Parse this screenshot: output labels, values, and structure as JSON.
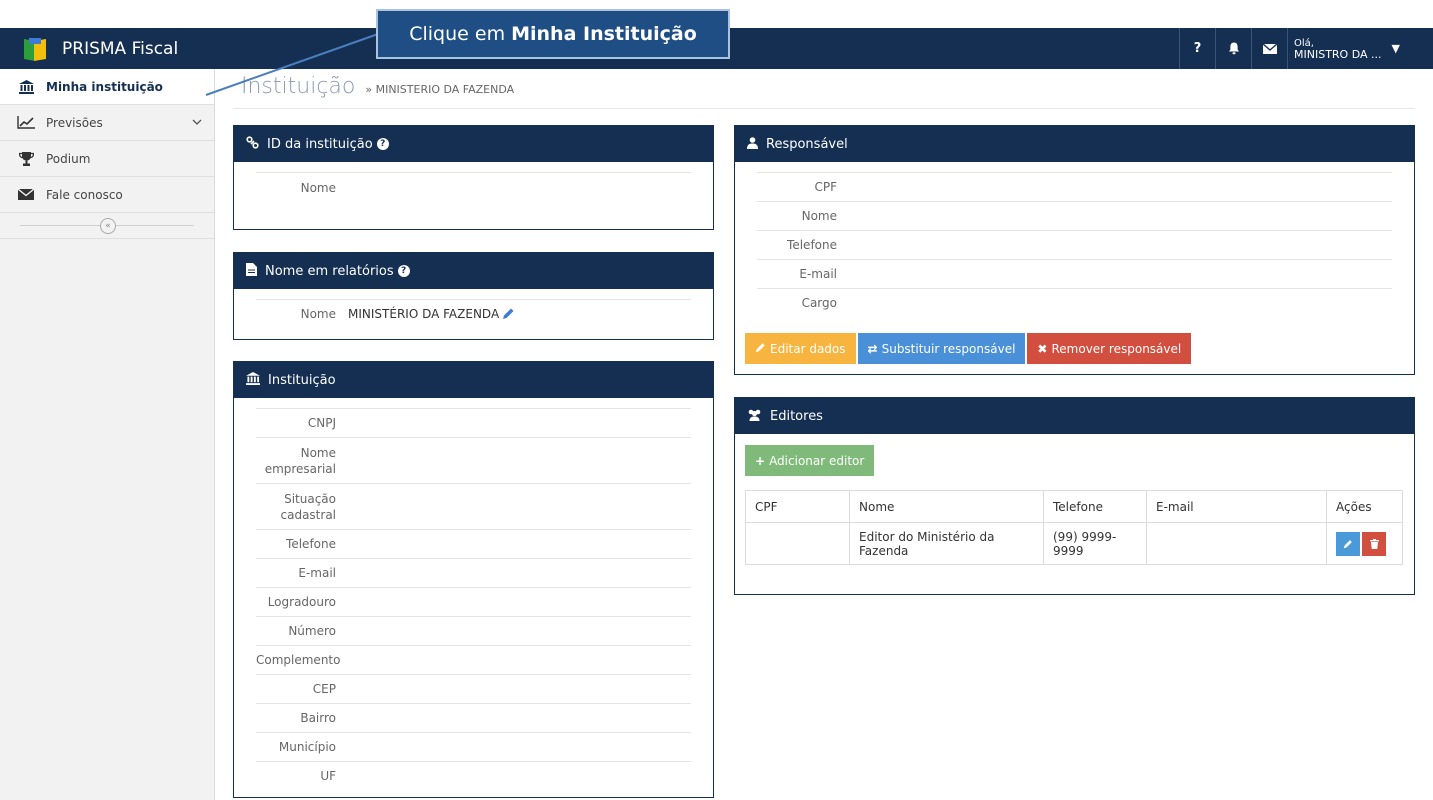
{
  "app": {
    "name": "PRISMA Fiscal"
  },
  "topbar": {
    "help": "?",
    "user_greeting": "Olá,",
    "user_name": "MINISTRO DA ..."
  },
  "callout": {
    "prefix": "Clique em",
    "bold": "Minha Instituição"
  },
  "sidebar": {
    "items": [
      {
        "label": "Minha instituição",
        "icon": "bank-icon"
      },
      {
        "label": "Previsões",
        "icon": "chart-line-icon"
      },
      {
        "label": "Podium",
        "icon": "trophy-icon"
      },
      {
        "label": "Fale conosco",
        "icon": "envelope-icon"
      }
    ],
    "collapse": "«"
  },
  "breadcrumb": {
    "title": "Instituição",
    "separator": "»",
    "current": "MINISTERIO DA FAZENDA"
  },
  "id_panel": {
    "title": "ID da instituição",
    "rows": [
      {
        "label": "Nome",
        "value": ""
      }
    ]
  },
  "report_panel": {
    "title": "Nome em relatórios",
    "rows": [
      {
        "label": "Nome",
        "value": "MINISTÉRIO DA FAZENDA"
      }
    ]
  },
  "institution_panel": {
    "title": "Instituição",
    "rows": [
      {
        "label": "CNPJ",
        "value": ""
      },
      {
        "label": "Nome empresarial",
        "value": ""
      },
      {
        "label": "Situação cadastral",
        "value": ""
      },
      {
        "label": "Telefone",
        "value": ""
      },
      {
        "label": "E-mail",
        "value": ""
      },
      {
        "label": "Logradouro",
        "value": ""
      },
      {
        "label": "Número",
        "value": ""
      },
      {
        "label": "Complemento",
        "value": ""
      },
      {
        "label": "CEP",
        "value": ""
      },
      {
        "label": "Bairro",
        "value": ""
      },
      {
        "label": "Município",
        "value": ""
      },
      {
        "label": "UF",
        "value": ""
      }
    ]
  },
  "responsible_panel": {
    "title": "Responsável",
    "rows": [
      {
        "label": "CPF",
        "value": ""
      },
      {
        "label": "Nome",
        "value": ""
      },
      {
        "label": "Telefone",
        "value": ""
      },
      {
        "label": "E-mail",
        "value": ""
      },
      {
        "label": "Cargo",
        "value": ""
      }
    ],
    "buttons": {
      "edit": "Editar dados",
      "replace": "Substituir responsável",
      "remove": "Remover responsável"
    }
  },
  "editors_panel": {
    "title": "Editores",
    "add_button": "Adicionar editor",
    "columns": [
      "CPF",
      "Nome",
      "Telefone",
      "E-mail",
      "Ações"
    ],
    "rows": [
      {
        "cpf": "",
        "nome": "Editor do Ministério da Fazenda",
        "telefone": "(99) 9999-9999",
        "email": ""
      }
    ]
  },
  "colors": {
    "navy": "#142f52",
    "orange": "#f7b540",
    "blue": "#4a90d9",
    "red": "#d24f3f",
    "green": "#7fba7a"
  }
}
